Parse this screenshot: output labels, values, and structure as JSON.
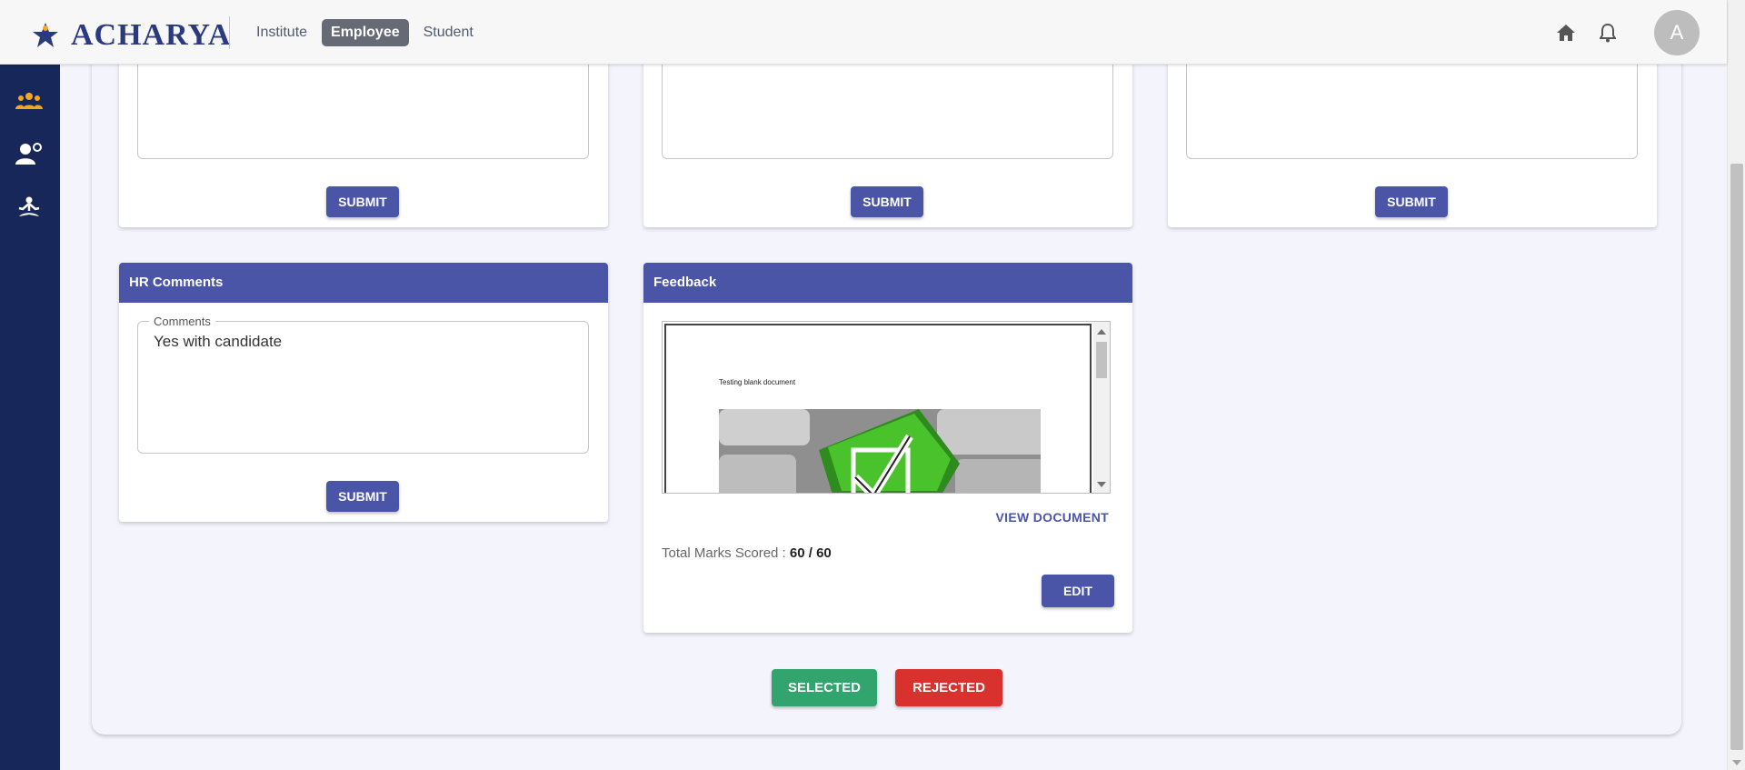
{
  "header": {
    "brand": "ACHARYA",
    "tabs": [
      {
        "label": "Institute",
        "active": false
      },
      {
        "label": "Employee",
        "active": true
      },
      {
        "label": "Student",
        "active": false
      }
    ],
    "icons": [
      "home-icon",
      "bell-icon"
    ],
    "avatar_initial": "A"
  },
  "sidebar": {
    "icons": [
      "group-icon",
      "user-settings-icon",
      "meditation-icon"
    ],
    "active_color": "#f5a623"
  },
  "cards": {
    "top_cards": [
      {
        "submit_label": "SUBMIT"
      },
      {
        "submit_label": "SUBMIT"
      },
      {
        "submit_label": "SUBMIT"
      }
    ],
    "hr_comments": {
      "title": "HR Comments",
      "field_label": "Comments",
      "value": "Yes with candidate",
      "submit_label": "SUBMIT"
    },
    "feedback": {
      "title": "Feedback",
      "document_text": "Testing blank document",
      "view_document_label": "VIEW DOCUMENT",
      "marks_label": "Total Marks Scored : ",
      "marks_value": "60 / 60",
      "edit_label": "EDIT"
    }
  },
  "actions": {
    "selected_label": "SELECTED",
    "rejected_label": "REJECTED"
  },
  "colors": {
    "primary": "#4b55a8",
    "sidebar": "#18275a",
    "selected": "#31a56d",
    "rejected": "#d9322e"
  }
}
